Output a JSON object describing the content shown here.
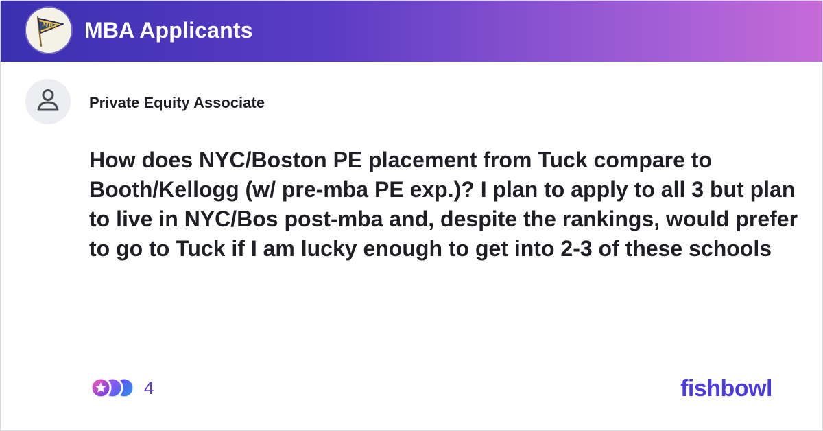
{
  "header": {
    "group_name": "MBA Applicants",
    "logo_text": "MBA",
    "gradient": [
      "#3a2fb0",
      "#5a3cc4",
      "#9a5ad4",
      "#c56bd8"
    ]
  },
  "post": {
    "author_title": "Private Equity Associate",
    "body": "How does NYC/Boston PE placement from Tuck compare to Booth/Kellogg (w/ pre-mba PE exp.)? I plan to apply to all 3 but plan to live in NYC/Bos post-mba and, despite the rankings, would prefer to go to Tuck if I am lucky enough to get into 2-3 of these schools",
    "reaction_count": "4"
  },
  "footer": {
    "brand": "fishbowl"
  },
  "icons": {
    "group_logo": "pennant-flag-icon",
    "avatar": "person-icon",
    "reactions": [
      "star-reaction-icon",
      "star-reaction-icon",
      "star-reaction-icon"
    ]
  },
  "colors": {
    "brand": "#4a3ce0",
    "reaction_count": "#5a3cc4",
    "text": "#1e1e24"
  }
}
